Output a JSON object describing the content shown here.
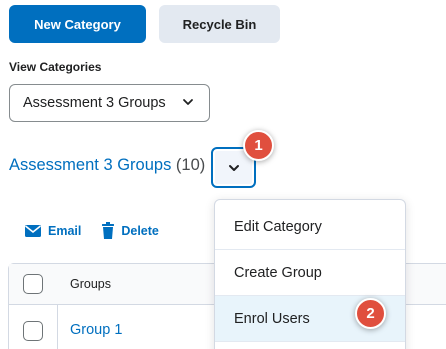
{
  "toolbar": {
    "new_category": "New Category",
    "recycle_bin": "Recycle Bin"
  },
  "view_categories": {
    "label": "View Categories",
    "selected": "Assessment 3 Groups"
  },
  "category": {
    "title": "Assessment 3 Groups",
    "count": "(10)"
  },
  "actions": {
    "email": "Email",
    "delete": "Delete"
  },
  "table": {
    "header": "Groups",
    "rows": [
      "Group 1"
    ]
  },
  "context_menu": {
    "items": [
      "Edit Category",
      "Create Group",
      "Enrol Users"
    ],
    "highlighted_index": 2
  },
  "markers": {
    "first": "1",
    "second": "2"
  },
  "colors": {
    "primary": "#006fbf",
    "marker": "#e04f3e",
    "highlight": "#e8f4fb"
  },
  "icons": [
    "chevron-down-icon",
    "mail-icon",
    "trash-icon"
  ]
}
